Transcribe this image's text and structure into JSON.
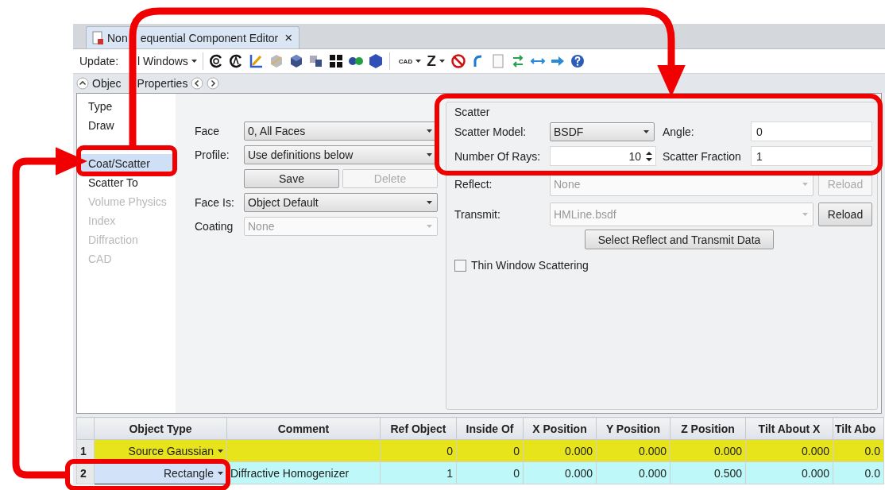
{
  "tab": {
    "title_parts": [
      "Non",
      "equential Component Editor"
    ],
    "close": "×"
  },
  "toolbar": {
    "update_parts": [
      "Update:",
      "l Windows"
    ],
    "cad": "CAD",
    "z": "Z"
  },
  "section": {
    "title_parts": [
      "Objec",
      "Properties"
    ]
  },
  "sidebar": {
    "items": [
      {
        "kind": "item",
        "label": "Type",
        "selected": false,
        "disabled": false
      },
      {
        "kind": "item",
        "label": "Draw",
        "selected": false,
        "disabled": false
      },
      {
        "kind": "covered"
      },
      {
        "kind": "item",
        "label": "Coat/Scatter",
        "selected": true,
        "disabled": false
      },
      {
        "kind": "item",
        "label": "Scatter To",
        "selected": false,
        "disabled": false
      },
      {
        "kind": "item",
        "label": "Volume Physics",
        "selected": false,
        "disabled": true
      },
      {
        "kind": "item",
        "label": "Index",
        "selected": false,
        "disabled": true
      },
      {
        "kind": "item",
        "label": "Diffraction",
        "selected": false,
        "disabled": true
      },
      {
        "kind": "item",
        "label": "CAD",
        "selected": false,
        "disabled": true
      }
    ]
  },
  "face_form": [
    {
      "kind": "select",
      "label": "Face",
      "value": "0, All Faces",
      "disabled": false
    },
    {
      "kind": "select",
      "label": "Profile:",
      "value": "Use definitions below",
      "disabled": false
    },
    {
      "kind": "buttons",
      "buttons": [
        {
          "label": "Save",
          "disabled": false
        },
        {
          "label": "Delete",
          "disabled": true
        }
      ]
    },
    {
      "kind": "select",
      "label": "Face Is:",
      "value": "Object Default",
      "disabled": false
    },
    {
      "kind": "select",
      "label": "Coating",
      "value": "None",
      "disabled": true
    }
  ],
  "scatter": {
    "title": "Scatter",
    "model": {
      "label": "Scatter Model:",
      "value": "BSDF"
    },
    "angle": {
      "label": "Angle:",
      "value": "0"
    },
    "rays": {
      "label": "Number Of Rays:",
      "value": "10"
    },
    "fraction": {
      "label": "Scatter Fraction",
      "value": "1"
    },
    "files": [
      {
        "label": "Reflect:",
        "value": "None",
        "reload": "Reload",
        "reload_disabled": true
      },
      {
        "label": "Transmit:",
        "value": "HMLine.bsdf",
        "reload": "Reload",
        "reload_disabled": false
      }
    ],
    "select_button": "Select Reflect and Transmit Data",
    "thin_window": {
      "label": "Thin Window Scattering",
      "checked": false
    }
  },
  "table": {
    "columns": [
      "Object Type",
      "Comment",
      "Ref Object",
      "Inside Of",
      "X Position",
      "Y Position",
      "Z Position",
      "Tilt About X",
      "Tilt Abo"
    ],
    "rows": [
      {
        "number": "1",
        "color": "#e8e41c",
        "type_selected": false,
        "cells": [
          "Source Gaussian",
          "",
          "0",
          "0",
          "0.000",
          "0.000",
          "0.000",
          "0.000",
          "0.0"
        ]
      },
      {
        "number": "2",
        "color": "#bef8f8",
        "type_selected": true,
        "cells": [
          "Rectangle",
          "Diffractive Homogenizer",
          "1",
          "0",
          "0.000",
          "0.000",
          "0.500",
          "0.000",
          "0.0"
        ]
      }
    ]
  }
}
